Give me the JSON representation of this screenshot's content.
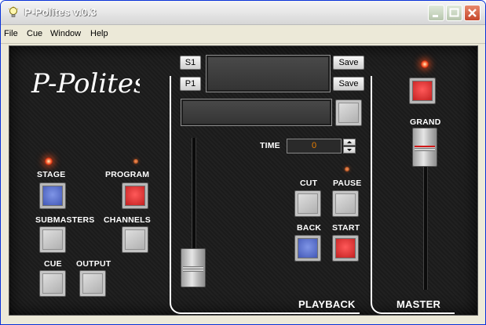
{
  "window": {
    "title": "P-Polites v.0.3"
  },
  "menu": [
    "File",
    "Cue",
    "Window",
    "Help"
  ],
  "logo": {
    "text": "P-Polites"
  },
  "left": {
    "stage_label": "STAGE",
    "program_label": "PROGRAM",
    "submasters_label": "SUBMASTERS",
    "channels_label": "CHANNELS",
    "cue_label": "CUE",
    "output_label": "OUTPUT"
  },
  "playback": {
    "s1_label": "S1",
    "p1_label": "P1",
    "save_label": "Save",
    "time_label": "TIME",
    "time_value": "0",
    "cut_label": "CUT",
    "pause_label": "PAUSE",
    "back_label": "BACK",
    "start_label": "START",
    "section_label": "PLAYBACK"
  },
  "master": {
    "grand_label": "GRAND",
    "section_label": "MASTER"
  },
  "colors": {
    "panel_bg": "#1c1c1c",
    "led": "#ff5a2a",
    "time_digit": "#e87d00",
    "button_blue": "#4a5fc8",
    "button_red": "#d01818"
  }
}
